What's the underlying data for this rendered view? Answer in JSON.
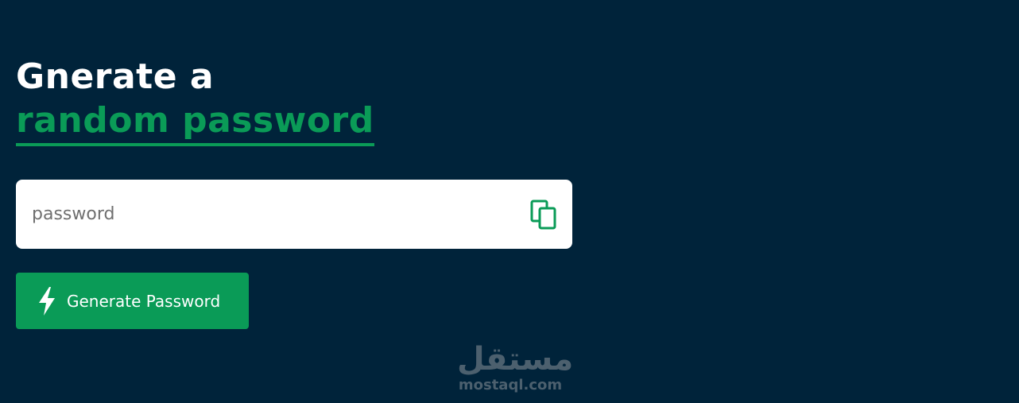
{
  "heading": {
    "line1": "Gnerate a",
    "line2": "random password"
  },
  "password_field": {
    "value": "",
    "placeholder": "password"
  },
  "copy_button": {
    "icon": "copy-icon"
  },
  "generate_button": {
    "label": "Generate Password",
    "icon": "lightning-bolt-icon"
  },
  "watermark": {
    "arabic": "مستقل",
    "domain": "mostaql.com"
  },
  "colors": {
    "background": "#00233a",
    "accent": "#0a9b57",
    "input_bg": "#ffffff",
    "button_text": "#ffffff"
  }
}
